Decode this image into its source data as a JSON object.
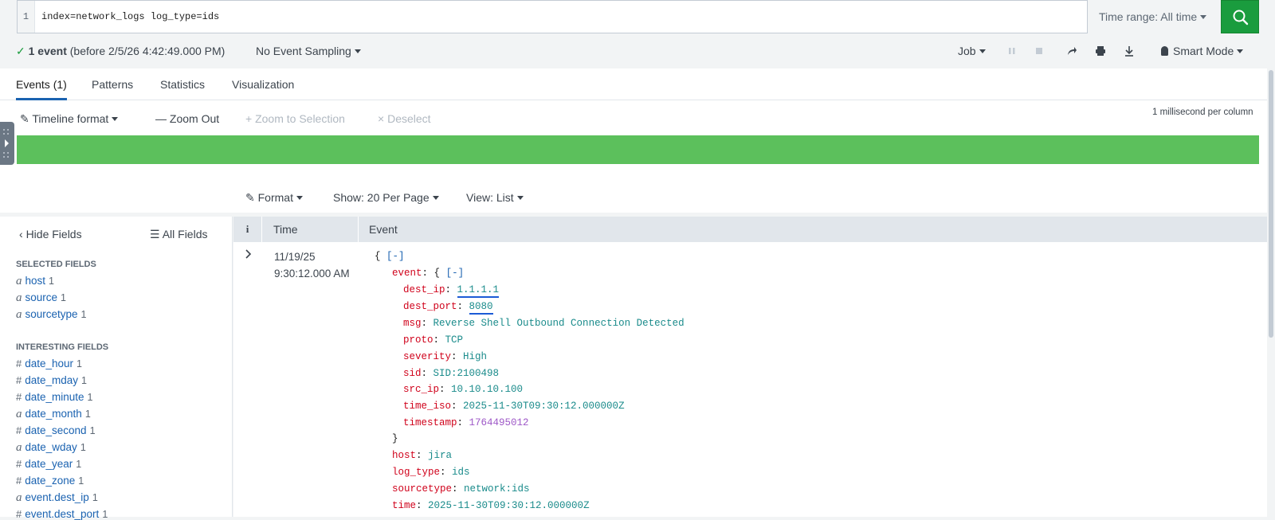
{
  "search": {
    "line_number": "1",
    "query": "index=network_logs log_type=ids",
    "time_range": "Time range: All time"
  },
  "status": {
    "check": "✓",
    "event_count": "1 event",
    "before": "(before 2/5/26 4:42:49.000 PM)",
    "sampling": "No Event Sampling",
    "job": "Job",
    "smart_mode": "Smart Mode"
  },
  "tabs": [
    {
      "label": "Events (1)",
      "active": true
    },
    {
      "label": "Patterns"
    },
    {
      "label": "Statistics"
    },
    {
      "label": "Visualization"
    }
  ],
  "timeline": {
    "format": "Timeline format",
    "zoom_out": "Zoom Out",
    "zoom_selection": "Zoom to Selection",
    "deselect": "Deselect",
    "scale": "1 millisecond per column"
  },
  "list_controls": {
    "format": "Format",
    "show": "Show: 20 Per Page",
    "view": "View: List"
  },
  "sidebar": {
    "hide_fields": "Hide Fields",
    "all_fields": "All Fields",
    "selected_title": "SELECTED FIELDS",
    "selected": [
      {
        "type": "a",
        "name": "host",
        "count": "1"
      },
      {
        "type": "a",
        "name": "source",
        "count": "1"
      },
      {
        "type": "a",
        "name": "sourcetype",
        "count": "1"
      }
    ],
    "interesting_title": "INTERESTING FIELDS",
    "interesting": [
      {
        "type": "#",
        "name": "date_hour",
        "count": "1"
      },
      {
        "type": "#",
        "name": "date_mday",
        "count": "1"
      },
      {
        "type": "#",
        "name": "date_minute",
        "count": "1"
      },
      {
        "type": "a",
        "name": "date_month",
        "count": "1"
      },
      {
        "type": "#",
        "name": "date_second",
        "count": "1"
      },
      {
        "type": "a",
        "name": "date_wday",
        "count": "1"
      },
      {
        "type": "#",
        "name": "date_year",
        "count": "1"
      },
      {
        "type": "#",
        "name": "date_zone",
        "count": "1"
      },
      {
        "type": "a",
        "name": "event.dest_ip",
        "count": "1"
      },
      {
        "type": "#",
        "name": "event.dest_port",
        "count": "1"
      }
    ]
  },
  "table": {
    "col_i": "i",
    "col_time": "Time",
    "col_event": "Event"
  },
  "event": {
    "date": "11/19/25",
    "time": "9:30:12.000 AM",
    "collapse": "[-]",
    "open_brace": "{",
    "close_brace": "}",
    "event_key": "event",
    "fields": [
      {
        "key": "dest_ip",
        "value": "1.1.1.1",
        "kind": "str",
        "underline": true
      },
      {
        "key": "dest_port",
        "value": "8080",
        "kind": "str",
        "underline": true
      },
      {
        "key": "msg",
        "value": "Reverse Shell Outbound Connection Detected",
        "kind": "str"
      },
      {
        "key": "proto",
        "value": "TCP",
        "kind": "str"
      },
      {
        "key": "severity",
        "value": "High",
        "kind": "str"
      },
      {
        "key": "sid",
        "value": "SID:2100498",
        "kind": "str"
      },
      {
        "key": "src_ip",
        "value": "10.10.10.100",
        "kind": "str"
      },
      {
        "key": "time_iso",
        "value": "2025-11-30T09:30:12.000000Z",
        "kind": "str"
      },
      {
        "key": "timestamp",
        "value": "1764495012",
        "kind": "num"
      }
    ],
    "top": [
      {
        "key": "host",
        "value": "jira"
      },
      {
        "key": "log_type",
        "value": "ids"
      },
      {
        "key": "sourcetype",
        "value": "network:ids"
      },
      {
        "key": "time",
        "value": "2025-11-30T09:30:12.000000Z"
      }
    ]
  },
  "colors": {
    "accent_green": "#1a9c3e",
    "timeline_green": "#5cc05c",
    "link_blue": "#1a62b0",
    "key_red": "#d0021b",
    "value_teal": "#1a8b8b",
    "number_purple": "#9e58c7"
  }
}
